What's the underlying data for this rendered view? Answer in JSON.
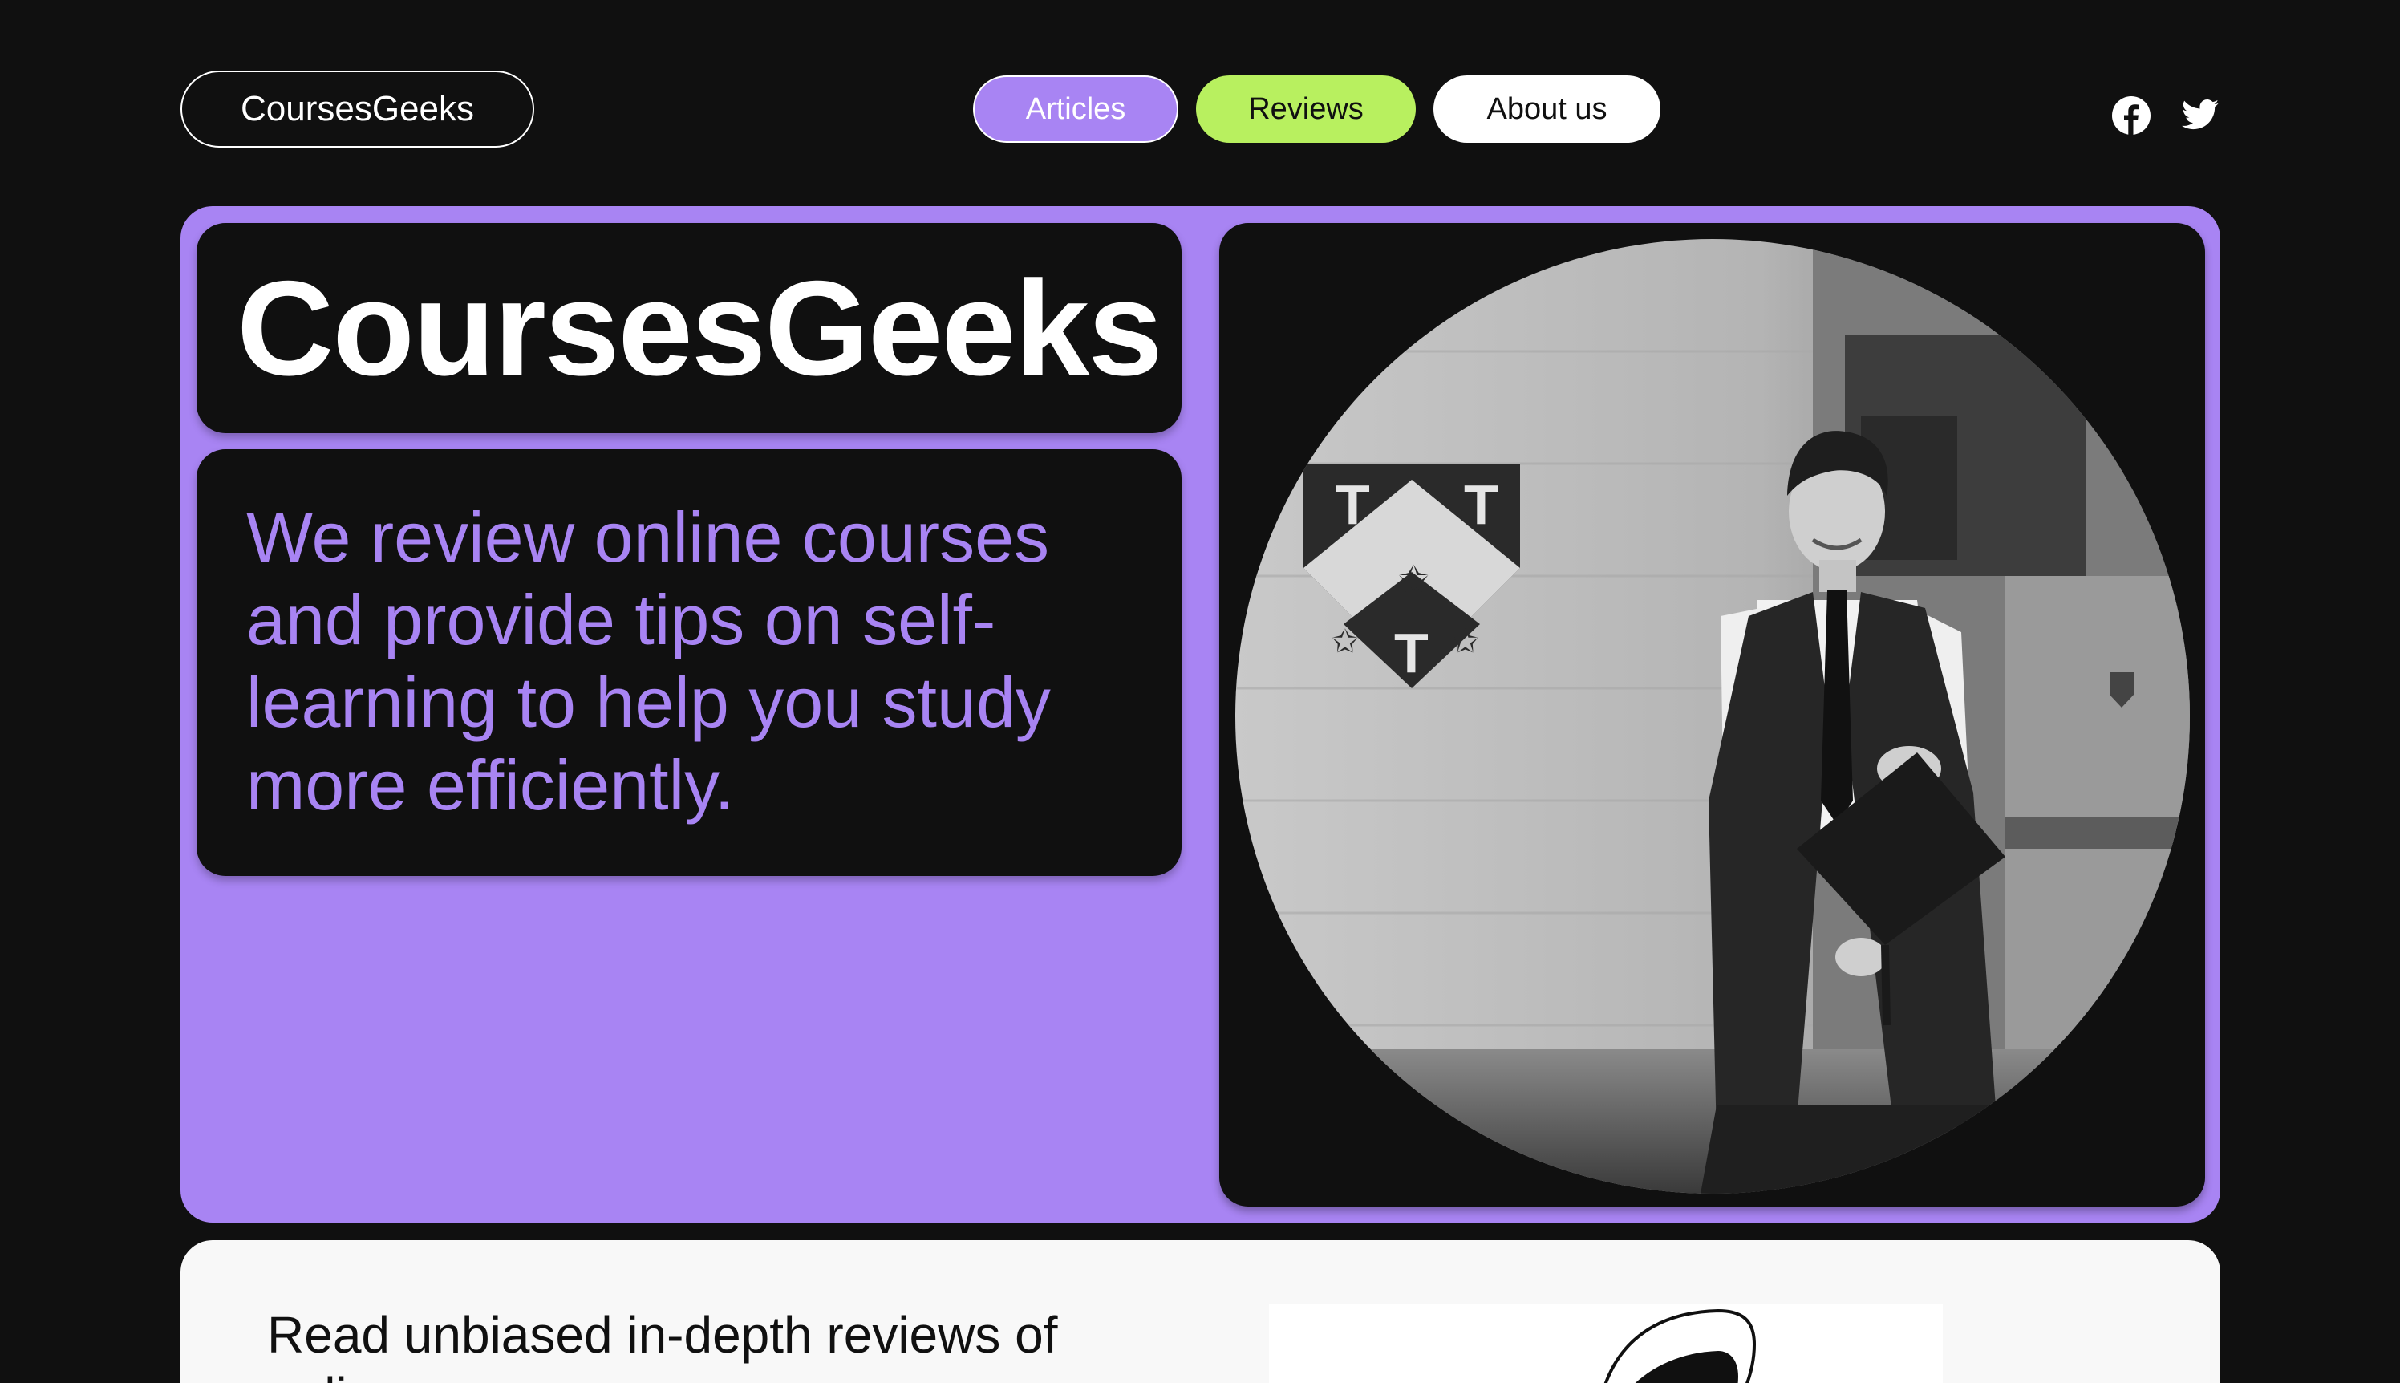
{
  "header": {
    "logo": "CoursesGeeks",
    "nav": [
      {
        "label": "Articles"
      },
      {
        "label": "Reviews"
      },
      {
        "label": "About us"
      }
    ],
    "social": [
      {
        "icon": "facebook-icon"
      },
      {
        "icon": "twitter-icon"
      }
    ]
  },
  "hero": {
    "title": "CoursesGeeks",
    "description": "We review online courses and provide tips on self-learning to help you study more efficiently.",
    "photo": {
      "crest_letters": [
        "T",
        "T",
        "T"
      ]
    }
  },
  "bottom": {
    "text": "Read unbiased in-depth reviews of online"
  },
  "colors": {
    "background": "#101010",
    "accent_purple": "#a884f3",
    "accent_green": "#b8f05f",
    "white": "#ffffff"
  }
}
